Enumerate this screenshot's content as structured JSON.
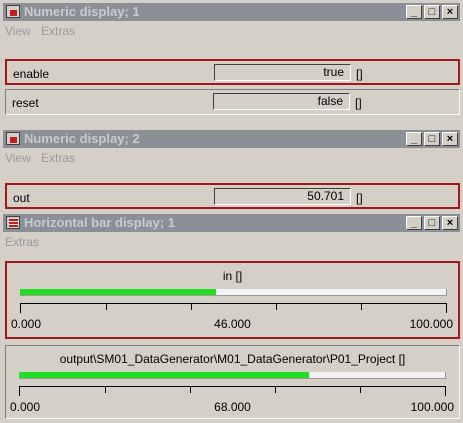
{
  "window1": {
    "title": "Numeric display; 1",
    "menu": [
      "View",
      "Extras"
    ],
    "rows": [
      {
        "label": "enable",
        "value": "true",
        "unit": "[]"
      },
      {
        "label": "reset",
        "value": "false",
        "unit": "[]"
      }
    ]
  },
  "window2": {
    "title": "Numeric display; 2",
    "menu": [
      "View",
      "Extras"
    ],
    "rows": [
      {
        "label": "out",
        "value": "50.701",
        "unit": "[]"
      }
    ]
  },
  "window3": {
    "title": "Horizontal bar display; 1",
    "menu": [
      "Extras"
    ],
    "bars": [
      {
        "title": "in []",
        "min_label": "0.000",
        "value_label": "46.000",
        "max_label": "100.000",
        "min": 0,
        "max": 100,
        "value": 46
      },
      {
        "title": "output\\SM01_DataGenerator\\M01_DataGenerator\\P01_Project  []",
        "min_label": "0.000",
        "value_label": "68.000",
        "max_label": "100.000",
        "min": 0,
        "max": 100,
        "value": 68
      }
    ]
  },
  "title_buttons": {
    "minimize": "_",
    "maximize": "□",
    "close": "×"
  },
  "colors": {
    "bar_fill": "#22dd22",
    "selection_border": "#a01818",
    "inactive_title": "#8b8f96"
  }
}
